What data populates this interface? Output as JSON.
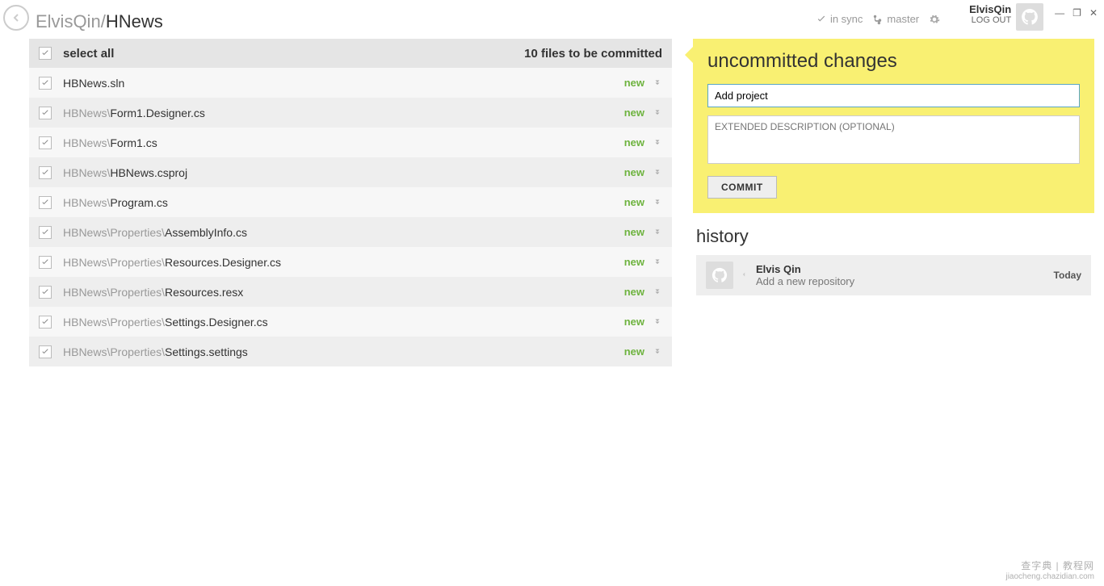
{
  "user": {
    "name": "ElvisQin",
    "logout": "LOG OUT"
  },
  "breadcrumb": {
    "owner": "ElvisQin",
    "sep": "/",
    "repo": "HNews"
  },
  "sync": {
    "status": "in sync",
    "branch": "master"
  },
  "list": {
    "select_all": "select all",
    "count_text": "10 files to be committed",
    "files": [
      {
        "prefix": "",
        "name": "HBNews.sln",
        "status": "new"
      },
      {
        "prefix": "HBNews\\",
        "name": "Form1.Designer.cs",
        "status": "new"
      },
      {
        "prefix": "HBNews\\",
        "name": "Form1.cs",
        "status": "new"
      },
      {
        "prefix": "HBNews\\",
        "name": "HBNews.csproj",
        "status": "new"
      },
      {
        "prefix": "HBNews\\",
        "name": "Program.cs",
        "status": "new"
      },
      {
        "prefix": "HBNews\\Properties\\",
        "name": "AssemblyInfo.cs",
        "status": "new"
      },
      {
        "prefix": "HBNews\\Properties\\",
        "name": "Resources.Designer.cs",
        "status": "new"
      },
      {
        "prefix": "HBNews\\Properties\\",
        "name": "Resources.resx",
        "status": "new"
      },
      {
        "prefix": "HBNews\\Properties\\",
        "name": "Settings.Designer.cs",
        "status": "new"
      },
      {
        "prefix": "HBNews\\Properties\\",
        "name": "Settings.settings",
        "status": "new"
      }
    ]
  },
  "commit": {
    "heading": "uncommitted changes",
    "summary_value": "Add project",
    "desc_placeholder": "EXTENDED DESCRIPTION (OPTIONAL)",
    "button": "COMMIT"
  },
  "history": {
    "heading": "history",
    "items": [
      {
        "author": "Elvis Qin",
        "message": "Add a new repository",
        "date": "Today"
      }
    ]
  },
  "watermark": {
    "line1": "查字典 | 教程网",
    "line2": "jiaocheng.chazidian.com"
  }
}
